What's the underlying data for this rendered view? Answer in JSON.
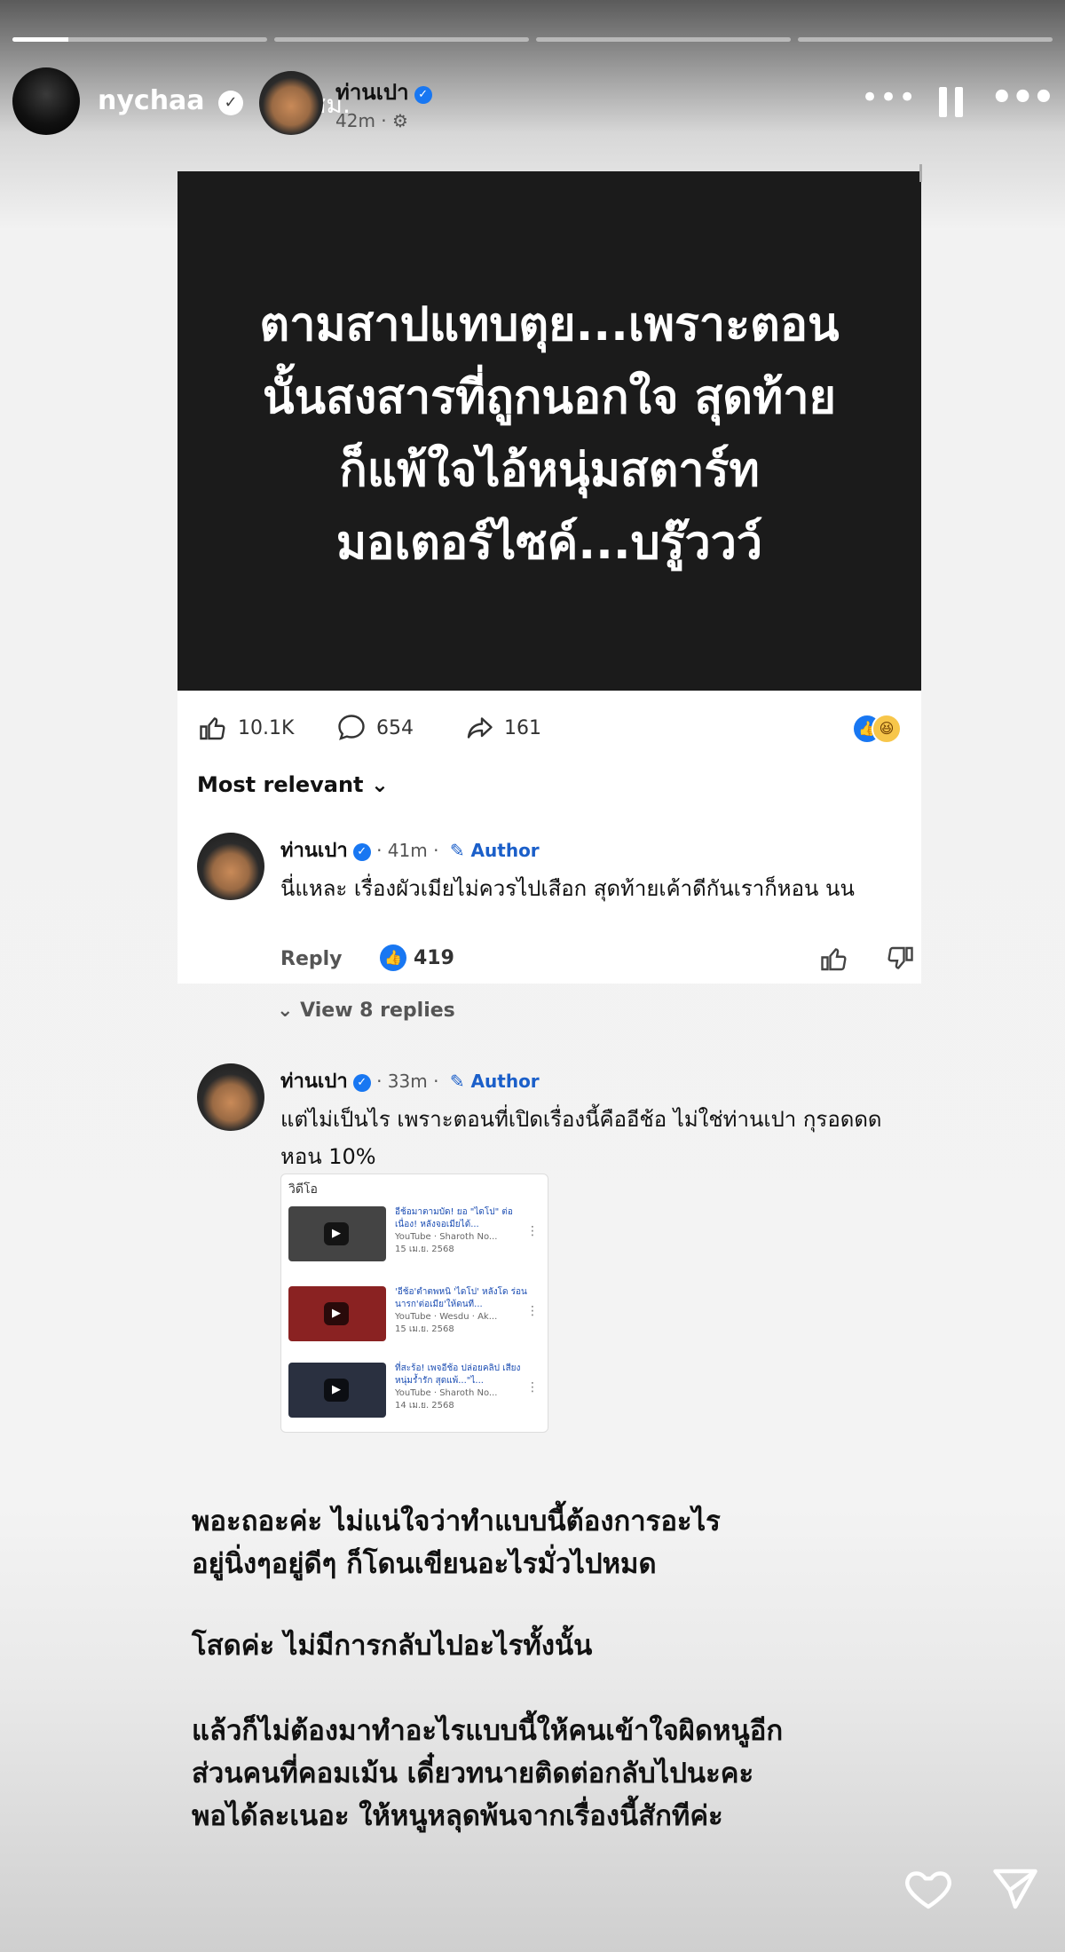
{
  "story": {
    "progress_segments": [
      1,
      0,
      0,
      0
    ],
    "username": "nychaa",
    "time": "10 ชม.",
    "more_label": "•••",
    "menu_label": "•••"
  },
  "fb_post": {
    "page_name": "ท่านเปา",
    "meta": "42m · ⚙",
    "text_lines": [
      "ตามสาปแทบตุย...เพราะตอน",
      "นั้นสงสารที่ถูกนอกใจ สุดท้าย",
      "ก็แพ้ใจไอ้หนุ่มสตาร์ท",
      "มอเตอร์ไซค์...บรู๊ววว์"
    ],
    "likes": "10.1K",
    "comments": "654",
    "shares": "161",
    "sort_label": "Most relevant ⌄"
  },
  "comments": [
    {
      "name": "ท่านเปา",
      "time": "· 41m ·",
      "badge": "✎ Author",
      "text": "นี่แหละ เรื่องผัวเมียไม่ควรไปเสือก สุดท้ายเค้าดีกันเราก็หอน นน",
      "reply": "Reply",
      "reactions": "419"
    },
    {
      "name": "ท่านเปา",
      "time": "· 33m ·",
      "badge": "✎ Author",
      "text": "แต่ไม่เป็นไร เพราะตอนที่เปิดเรื่องนี้คืออีช้อ ไม่ใช่ท่านเปา กุรอดดด หอน 10%"
    }
  ],
  "view_replies": "⌄ View 8 replies",
  "video_card": {
    "title": "วิดีโอ",
    "items": [
      {
        "title": "อีช้อมาตามบัด! ยอ \"ไดโป\" ต่อเนื่อง! หลังจอเมียได้...",
        "source": "YouTube · Sharoth No...",
        "date": "15 เม.ย. 2568",
        "color": "#444444"
      },
      {
        "title": "'อีช้อ'ตำตพหนิ 'ไดโป' หลังโด ร่อนนารก'ต่อเมีย'ให้ดนที...",
        "source": "YouTube · Wesdu · Ak...",
        "date": "15 เม.ย. 2568",
        "color": "#8a2222"
      },
      {
        "title": "ที่สะร้อ! เพจอีช้อ ปล่อยคลิป เสียงหนุ่มร้ำรัก สุดแพ้...\"ไ...",
        "source": "YouTube · Sharoth No...",
        "date": "14 เม.ย. 2568",
        "color": "#2a3040"
      }
    ]
  },
  "story_text": [
    "พอะถอะค่ะ ไม่แน่ใจว่าทำแบบนี้ต้องการอะไร",
    "อยู่นิ่งๆอยู่ดีๆ ก็โดนเขียนอะไรมั่วไปหมด",
    "โสดค่ะ ไม่มีการกลับไปอะไรทั้งนั้น",
    "แล้วก็ไม่ต้องมาทำอะไรแบบนี้ให้คนเข้าใจผิดหนูอีก",
    "ส่วนคนที่คอมเม้น เดี๋ยวทนายติดต่อกลับไปนะคะ",
    "พอได้ละเนอะ ให้หนูหลุดพ้นจากเรื่องนี้สักทีค่ะ"
  ]
}
